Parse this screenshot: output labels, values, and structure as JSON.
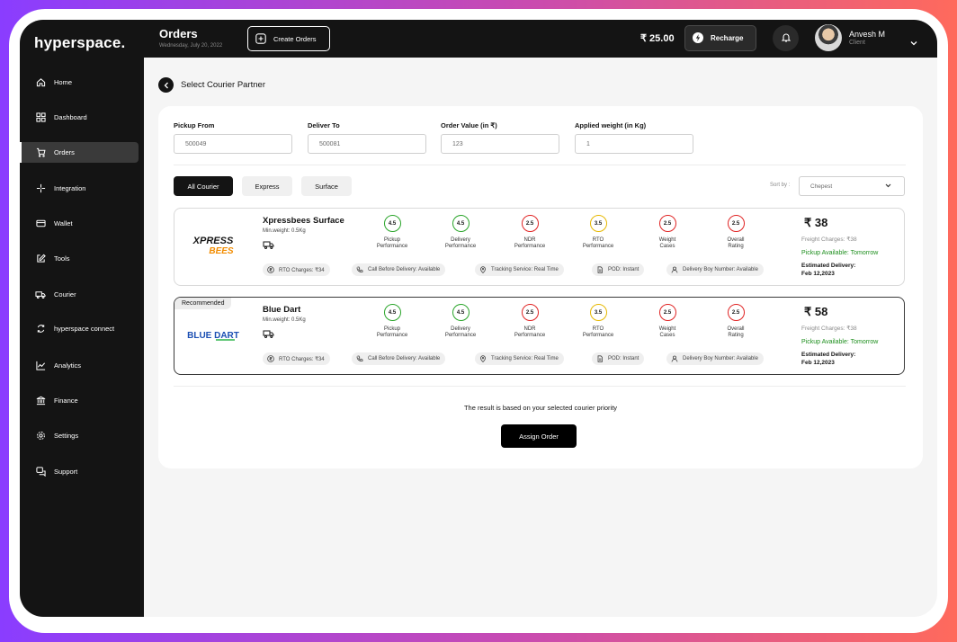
{
  "app": {
    "logo": "hyperspace."
  },
  "sidebar": {
    "items": [
      {
        "label": "Home",
        "icon": "home-icon"
      },
      {
        "label": "Dashboard",
        "icon": "dashboard-icon"
      },
      {
        "label": "Orders",
        "icon": "cart-icon",
        "active": true
      },
      {
        "label": "Integration",
        "icon": "integration-icon"
      },
      {
        "label": "Wallet",
        "icon": "wallet-icon"
      },
      {
        "label": "Tools",
        "icon": "tools-icon"
      },
      {
        "label": "Courier",
        "icon": "truck-icon"
      },
      {
        "label": "hyperspace connect",
        "icon": "connect-icon"
      },
      {
        "label": "Analytics",
        "icon": "analytics-icon"
      },
      {
        "label": "Finance",
        "icon": "bank-icon"
      },
      {
        "label": "Settings",
        "icon": "gear-icon"
      },
      {
        "label": "Support",
        "icon": "support-icon"
      }
    ]
  },
  "header": {
    "title": "Orders",
    "date": "Wednesday, July 20, 2022",
    "create_label": "Create Orders",
    "balance": "₹ 25.00",
    "recharge_label": "Recharge",
    "user_name": "Anvesh M",
    "user_role": "Client"
  },
  "main": {
    "section_title": "Select Courier Partner",
    "fields": [
      {
        "label": "Pickup From",
        "value": "500049"
      },
      {
        "label": "Deliver To",
        "value": "500081"
      },
      {
        "label": "Order Value (in ₹)",
        "value": "123"
      },
      {
        "label": "Applied weight (in Kg)",
        "value": "1"
      }
    ],
    "tabs": [
      {
        "label": "All Courier",
        "active": true
      },
      {
        "label": "Express",
        "active": false
      },
      {
        "label": "Surface",
        "active": false
      }
    ],
    "sort_label": "Sort by :",
    "sort_value": "Chepest",
    "metric_labels": [
      "Pickup\nPerformance",
      "Delivery\nPerformance",
      "NDR\nPerformance",
      "RTO\nPerformance",
      "Weight\nCases",
      "Overall\nRating"
    ],
    "couriers": [
      {
        "name": "Xpressbees Surface",
        "logo_line1": "XPRESS",
        "logo_line2": "BEES",
        "min_weight": "Min.weight: 0.5Kg",
        "recommended": false,
        "badge": "",
        "metrics": [
          "4.5",
          "4.5",
          "2.5",
          "3.5",
          "2.5",
          "2.5"
        ],
        "metric_colors": [
          "#2aa52a",
          "#2aa52a",
          "#e02424",
          "#e6b800",
          "#e02424",
          "#e02424"
        ],
        "chips": [
          "RTO Charges: ₹34",
          "Call Before Delivery: Available",
          "Tracking Service: Real Time",
          "POD: Instant",
          "Delivery Boy Number: Available"
        ],
        "price": "₹ 38",
        "freight": "Freight Charges: ₹38",
        "pickup": "Pickup Available: Tomorrow",
        "estimated_label": "Estimated Delivery:",
        "estimated_date": "Feb 12,2023"
      },
      {
        "name": "Blue Dart",
        "logo_line1": "BLUE DART",
        "logo_line2": "",
        "min_weight": "Min.weight: 0.5Kg",
        "recommended": true,
        "badge": "Recommended",
        "metrics": [
          "4.5",
          "4.5",
          "2.5",
          "3.5",
          "2.5",
          "2.5"
        ],
        "metric_colors": [
          "#2aa52a",
          "#2aa52a",
          "#e02424",
          "#e6b800",
          "#e02424",
          "#e02424"
        ],
        "chips": [
          "RTO Charges: ₹34",
          "Call Before Delivery: Available",
          "Tracking Service: Real Time",
          "POD: Instant",
          "Delivery Boy Number: Available"
        ],
        "price": "₹ 58",
        "freight": "Freight Charges: ₹38",
        "pickup": "Pickup Available: Tomorrow",
        "estimated_label": "Estimated Delivery:",
        "estimated_date": "Feb 12,2023"
      }
    ],
    "result_text": "The result is based on your selected courier priority",
    "assign_label": "Assign Order"
  },
  "colors": {
    "accent_dark": "#141414",
    "rating_good": "#2aa52a",
    "rating_mid": "#e6b800",
    "rating_bad": "#e02424",
    "pickup_green": "#1e8f1e",
    "xpressbees_orange": "#f28c00",
    "bluedart_blue": "#1b4fb3",
    "bluedart_green": "#2bb34a"
  }
}
